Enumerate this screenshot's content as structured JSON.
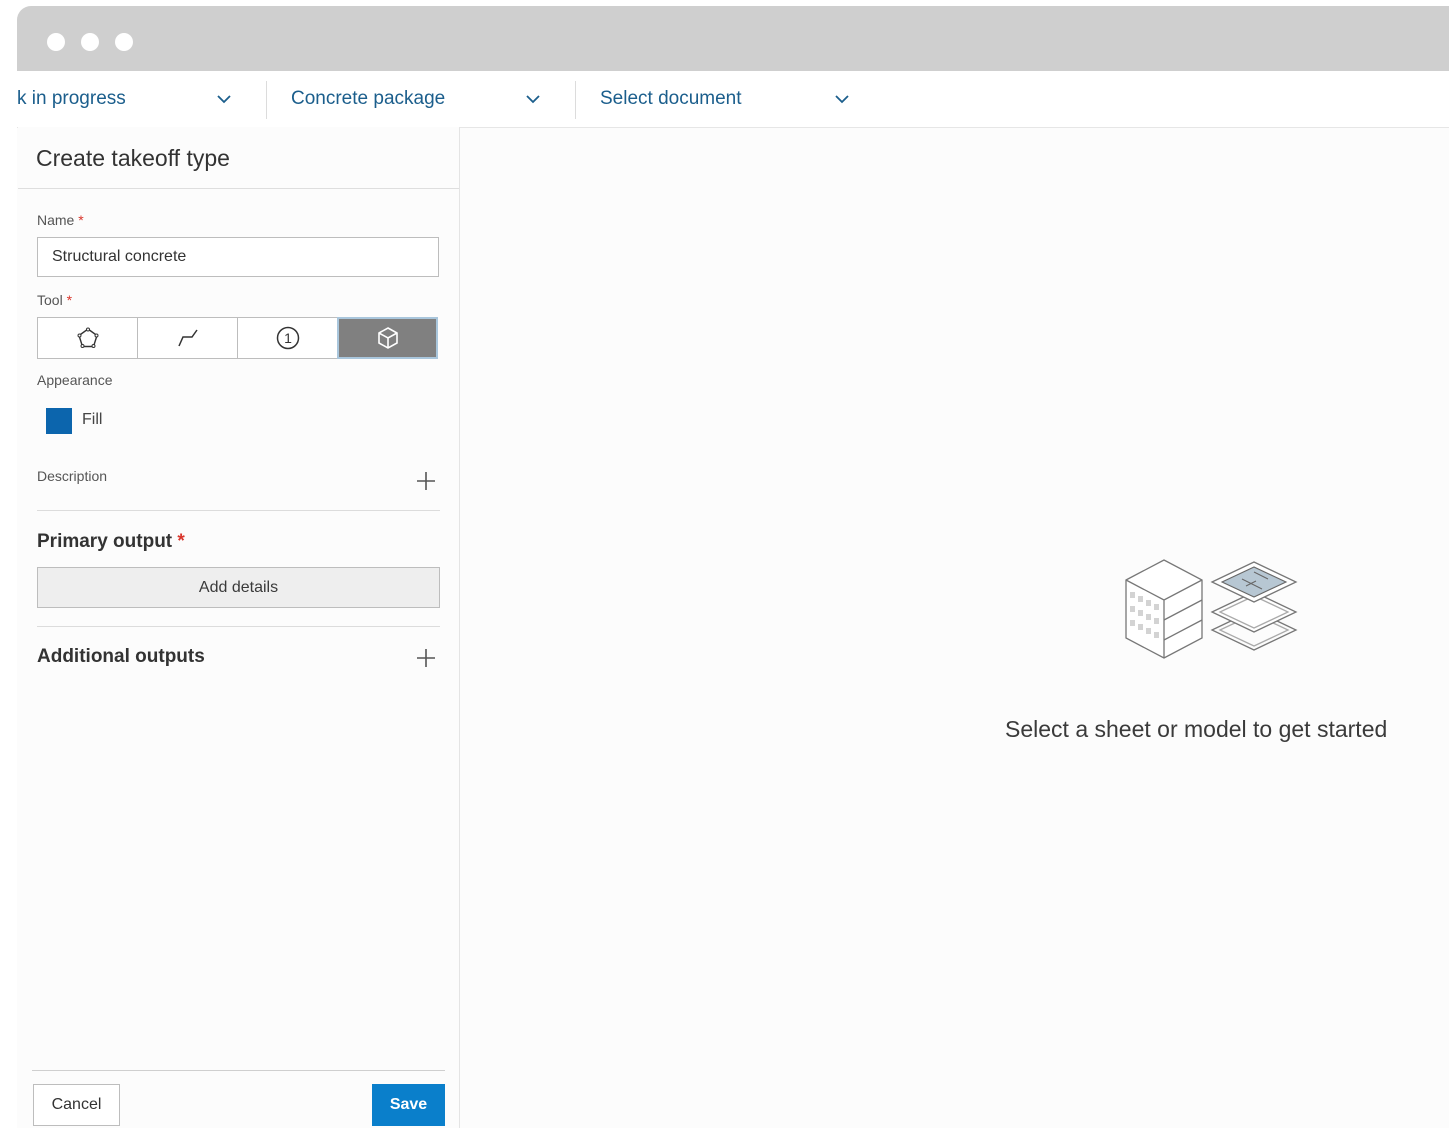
{
  "toolbar": {
    "status_dropdown": "k in progress",
    "package_dropdown": "Concrete package",
    "document_dropdown": "Select document"
  },
  "panel": {
    "title": "Create takeoff type",
    "name_label": "Name",
    "required_mark": "*",
    "name_value": "Structural concrete",
    "tool_label": "Tool",
    "tools": [
      "area-tool-icon",
      "linear-tool-icon",
      "count-tool-icon",
      "volume-tool-icon"
    ],
    "selected_tool": "volume-tool-icon",
    "appearance_label": "Appearance",
    "appearance_color": "#0c65ad",
    "fill_label": "Fill",
    "description_label": "Description",
    "primary_output_label": "Primary output",
    "add_details_label": "Add details",
    "additional_outputs_label": "Additional outputs",
    "cancel_label": "Cancel",
    "save_label": "Save"
  },
  "main": {
    "empty_message": "Select a sheet or model to get started"
  },
  "colors": {
    "accent": "#0a7fcb",
    "link": "#1b5e8c",
    "required": "#d9352b"
  }
}
